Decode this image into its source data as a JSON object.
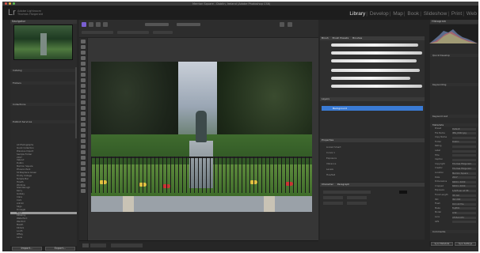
{
  "window": {
    "title": "Merrion Square - Dublin, Ireland (Adobe Photoshop CS6)"
  },
  "identity_plate": {
    "line1": "Adobe Lightroom",
    "line2": "Thomas Fitzgerald",
    "logo": "Lr"
  },
  "modules": {
    "items": [
      "Library",
      "Develop",
      "Map",
      "Book",
      "Slideshow",
      "Print",
      "Web"
    ],
    "active": "Library"
  },
  "navigator": {
    "label": "Navigator"
  },
  "left_panels": {
    "catalog": "Catalog",
    "folders": "Folders",
    "collections": "Collections",
    "publish": "Publish Services"
  },
  "folder_rows": [
    "All Photographs",
    "Quick Collection",
    "Previous Import",
    "Sample Folder",
    "2017",
    "Ireland",
    "Dublin",
    "Merrion Square",
    "Phoenix Park",
    "St Stephens Green",
    "Trinity College",
    "Temple Bar",
    "Howth",
    "Wicklow",
    "Glendalough",
    "Kerry",
    "Galway",
    "Clare",
    "Cork",
    "Antrim",
    "Sligo",
    "Donegal",
    "Mayo",
    "Kilkenny",
    "Waterford",
    "Wexford",
    "Meath",
    "Kildare",
    "Louth",
    "Offaly",
    "Laois"
  ],
  "left_buttons": {
    "import": "Import...",
    "export": "Export..."
  },
  "brushes_panel": {
    "tabs": [
      "Brush",
      "Brush Presets",
      "Brushes"
    ]
  },
  "layers_panel": {
    "label": "Layers",
    "layer_name": "Background"
  },
  "props_panel": {
    "label": "Properties",
    "rows": [
      "Linked Smart",
      "Curve 1",
      "Exposure",
      "Vibrance",
      "Levels",
      "Hue/Sat"
    ]
  },
  "char_panel": {
    "label": "Character",
    "label2": "Paragraph"
  },
  "right_panel": {
    "histogram": "Histogram",
    "quick_develop": "Quick Develop",
    "keywording": "Keywording",
    "keyword_list": "Keyword List",
    "metadata": "Metadata",
    "comments": "Comments",
    "rows": [
      [
        "Preset",
        "Default"
      ],
      [
        "File Name",
        "IMG_0042.jpg"
      ],
      [
        "Copy Name",
        ""
      ],
      [
        "Folder",
        "Dublin"
      ],
      [
        "Rating",
        ""
      ],
      [
        "Label",
        ""
      ],
      [
        "Title",
        ""
      ],
      [
        "Caption",
        ""
      ],
      [
        "Copyright",
        "Thomas Fitzgerald"
      ],
      [
        "Creator",
        "Thomas Fitzgerald"
      ],
      [
        "Location",
        "Merrion Square"
      ],
      [
        "Date",
        "2017"
      ],
      [
        "Dimensions",
        "6000 x 4000"
      ],
      [
        "Cropped",
        "6000 x 4000"
      ],
      [
        "Exposure",
        "1/125 sec at f/8"
      ],
      [
        "Focal Length",
        "35 mm"
      ],
      [
        "ISO",
        "ISO 200"
      ],
      [
        "Flash",
        "Did not fire"
      ],
      [
        "Make",
        "Fujifilm"
      ],
      [
        "Model",
        "X-T2"
      ],
      [
        "Lens",
        "XF35mmF2"
      ],
      [
        "GPS",
        ""
      ]
    ],
    "sync_buttons": [
      "Sync Metadata",
      "Sync Settings"
    ]
  }
}
